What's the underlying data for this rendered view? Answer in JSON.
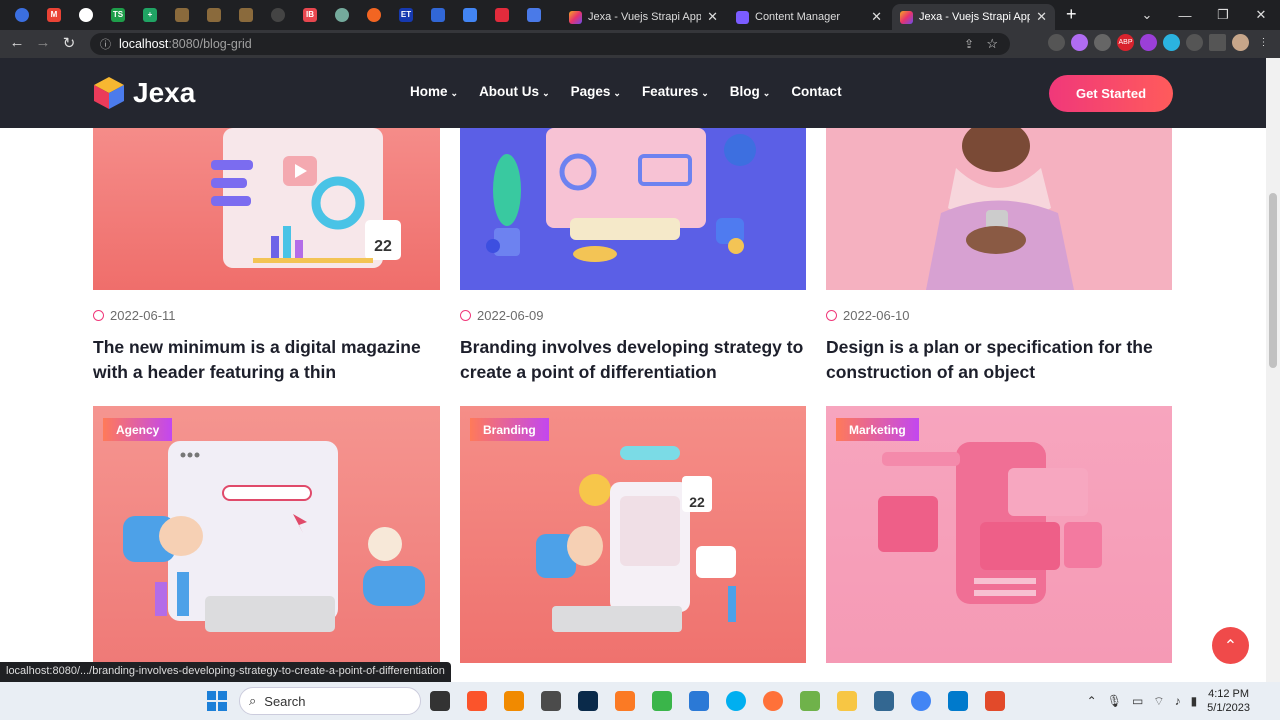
{
  "browser": {
    "tabs": [
      {
        "title": "Jexa - Vuejs Strapi App &",
        "color": "#6a4cf0"
      },
      {
        "title": "Content Manager",
        "color": "#7b5cff"
      },
      {
        "title": "Jexa - Vuejs Strapi App &",
        "color": "#6a4cf0"
      }
    ],
    "url_host": "localhost",
    "url_path": ":8080/blog-grid",
    "pinned_favicons": [
      "edge-icon",
      "gmail-icon",
      "chrome-icon",
      "ts-icon",
      "sheets-icon",
      "bookmark-icon",
      "bookmark-icon",
      "bookmark-icon",
      "github-icon",
      "hb-icon",
      "gpt-icon",
      "ext-icon",
      "et-icon",
      "ext-icon",
      "docs-icon",
      "ext-icon",
      "translate-icon"
    ],
    "status_url": "localhost:8080/.../branding-involves-developing-strategy-to-create-a-point-of-differentiation"
  },
  "site": {
    "logo_text": "Jexa",
    "menu": [
      "Home",
      "About Us",
      "Pages",
      "Features",
      "Blog",
      "Contact"
    ],
    "menu_has_dropdown": [
      true,
      true,
      true,
      true,
      true,
      false
    ],
    "cta": "Get Started"
  },
  "posts": [
    {
      "date": "2022-06-11",
      "title": "The new minimum is a digital magazine with a header featuring a thin",
      "bg": "#f07a78"
    },
    {
      "date": "2022-06-09",
      "title": "Branding involves developing strategy to create a point of differentiation",
      "bg": "#5b5fe6"
    },
    {
      "date": "2022-06-10",
      "title": "Design is a plan or specification for the construction of an object",
      "bg": "#f3a8b5"
    }
  ],
  "posts_row2": [
    {
      "tag": "Agency",
      "bg": "#f38a86"
    },
    {
      "tag": "Branding",
      "bg": "#f2807c"
    },
    {
      "tag": "Marketing",
      "bg": "#f7a6bd"
    }
  ],
  "taskbar": {
    "search_placeholder": "Search",
    "time": "4:12 PM",
    "date": "5/1/2023"
  }
}
